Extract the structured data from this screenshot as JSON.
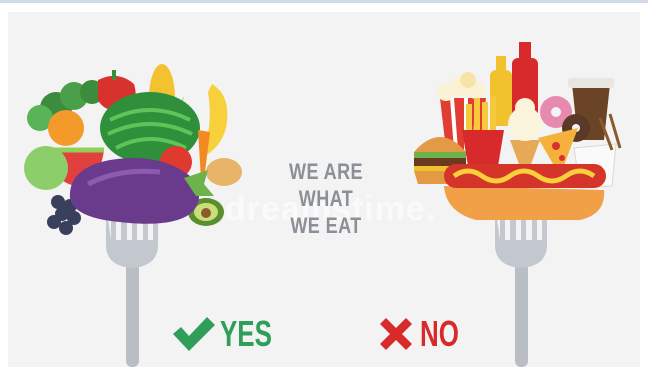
{
  "headline": {
    "line1": "WE ARE WHAT",
    "line2": "WE EAT"
  },
  "watermark": "dreamstime.",
  "healthy": {
    "label": "YES",
    "icon": "checkmark-icon",
    "color": "#2e9e58"
  },
  "junk": {
    "label": "NO",
    "icon": "cross-icon",
    "color": "#d82a2a"
  },
  "colors": {
    "background": "#f3f3f4",
    "fork": "#b9bec4",
    "text": "#8b8f96"
  }
}
